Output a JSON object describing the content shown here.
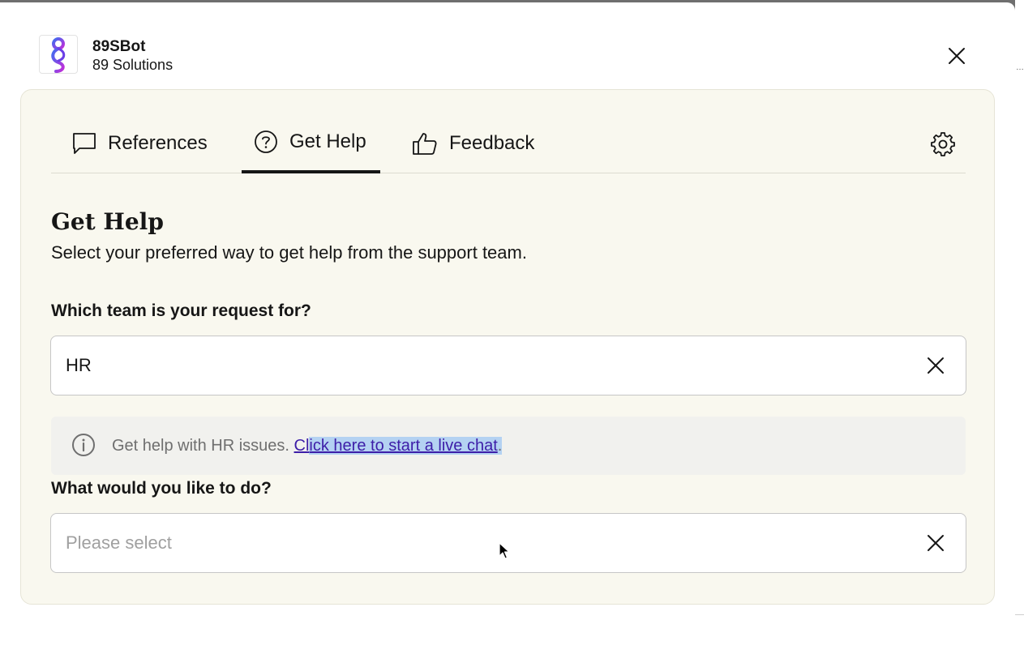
{
  "header": {
    "bot_name": "89SBot",
    "company": "89 Solutions"
  },
  "tabs": [
    {
      "label": "References",
      "icon": "chat-bubble-icon",
      "active": false
    },
    {
      "label": "Get Help",
      "icon": "help-circle-icon",
      "active": true
    },
    {
      "label": "Feedback",
      "icon": "thumbs-up-icon",
      "active": false
    }
  ],
  "get_help": {
    "title": "Get Help",
    "subtitle": "Select your preferred way to get help from the support team.",
    "team_question": "Which team is your request for?",
    "team_value": "HR",
    "info_prefix": "Get help with HR issues. ",
    "info_link_part1": "Cl",
    "info_link_part2": "ick here to start a live chat",
    "info_suffix": ".",
    "action_question": "What would you like to do?",
    "action_placeholder": "Please select"
  },
  "colors": {
    "panel_background": "#f9f8ef",
    "link": "#3d1ea8",
    "selection_highlight": "#b4d2f2",
    "logo_gradient_start": "#3f6df0",
    "logo_gradient_end": "#c32dd9"
  }
}
